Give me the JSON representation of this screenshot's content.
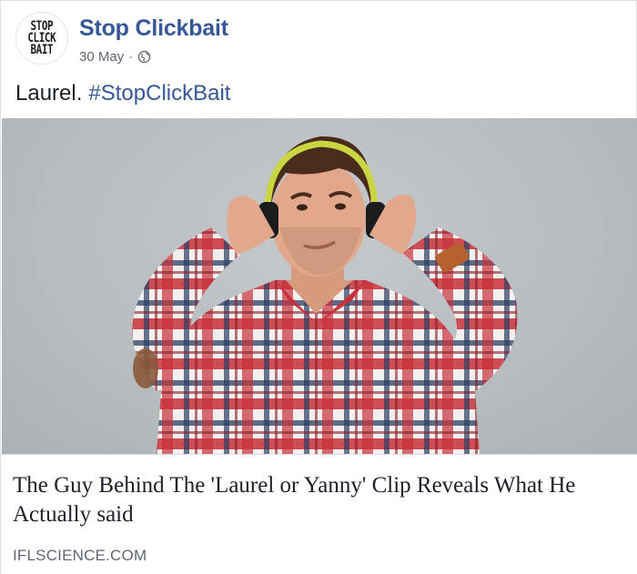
{
  "page": {
    "name": "Stop Clickbait",
    "avatar_lines": [
      "STOP",
      "CLICK",
      "BAIT"
    ]
  },
  "post": {
    "date": "30 May",
    "separator": "·",
    "privacy_icon": "globe-icon",
    "caption_text": "Laurel.",
    "hashtag": "#StopClickBait"
  },
  "link_preview": {
    "image_icon": "man-with-headphones-photo",
    "headline": "The Guy Behind The 'Laurel or Yanny' Clip Reveals What He Actually said",
    "domain": "IFLSCIENCE.COM"
  },
  "colors": {
    "link_blue": "#365899",
    "meta_gray": "#616770",
    "border": "#dddfe2"
  }
}
